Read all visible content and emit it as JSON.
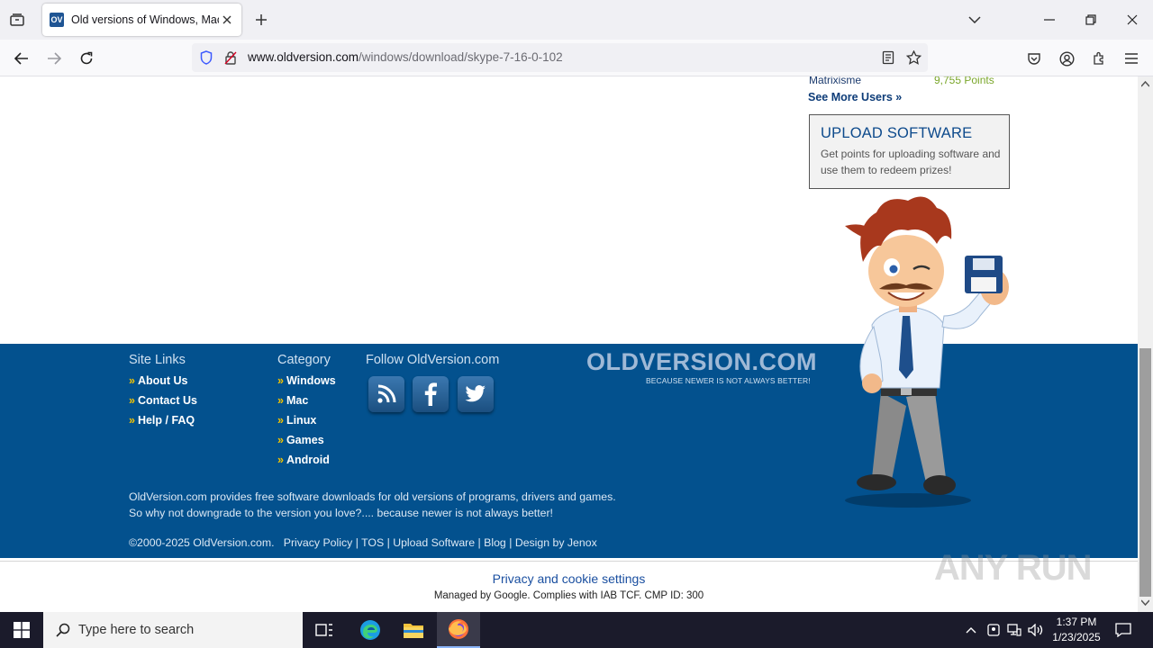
{
  "browser": {
    "tab": {
      "favicon_text": "OV",
      "title": "Old versions of Windows, Mac"
    },
    "url": {
      "host": "www.oldversion.com",
      "path": "/windows/download/skype-7-16-0-102"
    }
  },
  "sidebar": {
    "user": {
      "name": "Matrixisme",
      "points": "9,755 Points"
    },
    "see_more": "See More Users »",
    "upload": {
      "title": "UPLOAD SOFTWARE",
      "description": "Get points for uploading software and use them to redeem prizes!"
    }
  },
  "footer": {
    "site_links": {
      "title": "Site Links",
      "items": [
        "About Us",
        "Contact Us",
        "Help / FAQ"
      ]
    },
    "category": {
      "title": "Category",
      "items": [
        "Windows",
        "Mac",
        "Linux",
        "Games",
        "Android"
      ]
    },
    "follow": {
      "title": "Follow OldVersion.com"
    },
    "brand": {
      "name": "OLDVERSION.COM",
      "tagline": "BECAUSE NEWER IS NOT ALWAYS BETTER!"
    },
    "about_line1": "OldVersion.com provides free software downloads for old versions of programs, drivers and games.",
    "about_line2": "So why not downgrade to the version you love?.... because newer is not always better!",
    "copyright": "©2000-2025 OldVersion.com.",
    "links": [
      "Privacy Policy",
      "TOS",
      "Upload Software",
      "Blog",
      "Design by Jenox"
    ]
  },
  "cookie": {
    "title": "Privacy and cookie settings",
    "subtitle": "Managed by Google. Complies with IAB TCF. CMP ID: 300"
  },
  "watermark": "ANY RUN",
  "taskbar": {
    "search_placeholder": "Type here to search",
    "time": "1:37 PM",
    "date": "1/23/2025"
  }
}
